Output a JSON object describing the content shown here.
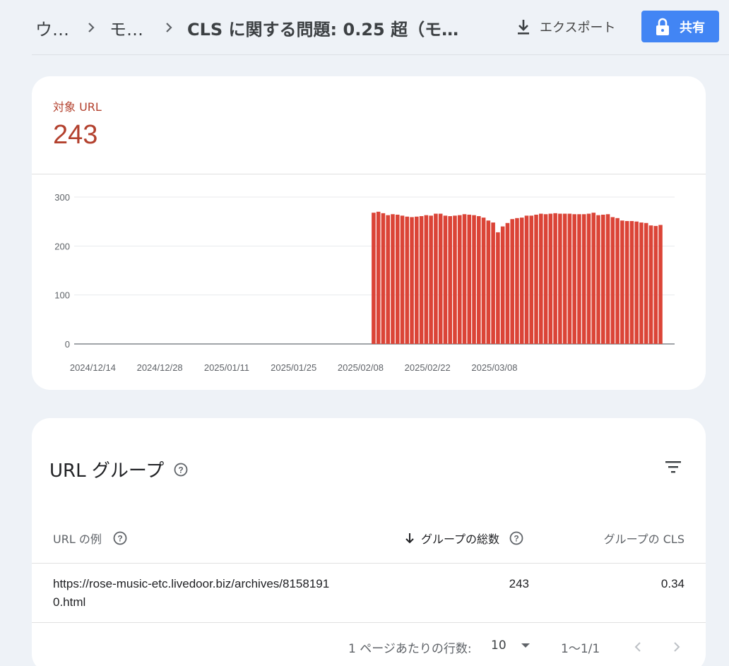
{
  "header": {
    "breadcrumbs": [
      "ウ…",
      "モ…"
    ],
    "title": "CLS に関する問題: 0.25 超（モ…",
    "export_label": "エクスポート",
    "share_label": "共有"
  },
  "metric": {
    "label": "対象 URL",
    "value": "243",
    "color": "#b3412e"
  },
  "chart_data": {
    "type": "bar",
    "color": "#db4437",
    "ylim": [
      0,
      300
    ],
    "yticks": [
      0,
      100,
      200,
      300
    ],
    "xtick_labels": [
      "2024/12/14",
      "2024/12/28",
      "2025/01/11",
      "2025/01/25",
      "2025/02/08",
      "2025/02/22",
      "2025/03/08"
    ],
    "grid": true,
    "x_start": "2024/12/14",
    "x_end": "2025/03/10",
    "values": [
      0,
      0,
      0,
      0,
      0,
      0,
      0,
      0,
      0,
      0,
      0,
      0,
      0,
      0,
      0,
      0,
      0,
      0,
      0,
      0,
      0,
      0,
      0,
      0,
      0,
      0,
      0,
      0,
      0,
      0,
      0,
      0,
      0,
      0,
      0,
      0,
      0,
      0,
      0,
      0,
      0,
      0,
      0,
      0,
      0,
      0,
      0,
      0,
      0,
      0,
      0,
      0,
      0,
      0,
      0,
      0,
      0,
      0,
      0,
      0,
      268,
      270,
      267,
      263,
      265,
      264,
      262,
      260,
      259,
      260,
      261,
      263,
      262,
      266,
      266,
      262,
      261,
      262,
      263,
      265,
      264,
      263,
      261,
      258,
      252,
      248,
      228,
      240,
      247,
      255,
      257,
      258,
      262,
      262,
      264,
      266,
      265,
      266,
      267,
      266,
      266,
      266,
      265,
      265,
      265,
      266,
      268,
      263,
      264,
      265,
      259,
      257,
      252,
      251,
      251,
      250,
      248,
      247,
      242,
      241,
      243
    ]
  },
  "table": {
    "title": "URL グループ",
    "columns": {
      "url_example": "URL の例",
      "group_total": "グループの総数",
      "group_cls": "グループの CLS"
    },
    "rows": [
      {
        "url_line1": "https://rose-music-etc.livedoor.biz/archives/8158191",
        "url_line2": "0.html",
        "total": "243",
        "cls": "0.34"
      }
    ],
    "pagination": {
      "rows_per_page_label": "1 ページあたりの行数:",
      "rows_per_page": "10",
      "range": "1〜1/1"
    }
  }
}
